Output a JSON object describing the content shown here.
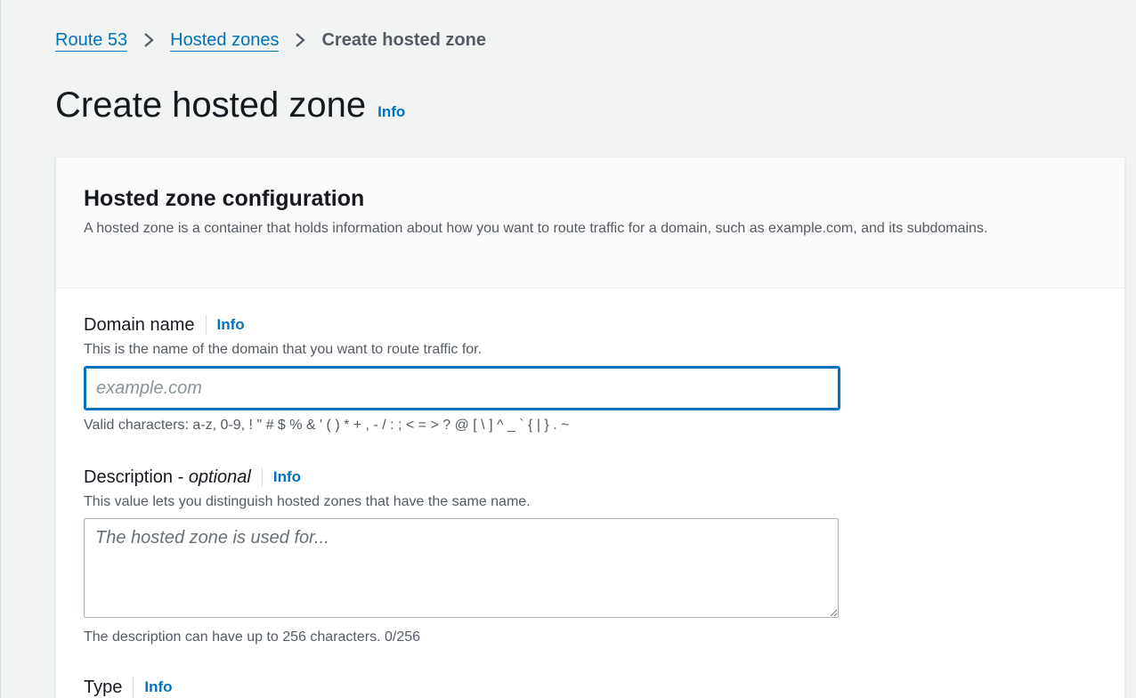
{
  "breadcrumb": {
    "items": [
      "Route 53",
      "Hosted zones"
    ],
    "current": "Create hosted zone"
  },
  "header": {
    "title": "Create hosted zone",
    "info": "Info"
  },
  "panel": {
    "title": "Hosted zone configuration",
    "description": "A hosted zone is a container that holds information about how you want to route traffic for a domain, such as example.com, and its subdomains."
  },
  "domain_name": {
    "label": "Domain name",
    "info": "Info",
    "description": "This is the name of the domain that you want to route traffic for.",
    "placeholder": "example.com",
    "value": "",
    "hint": "Valid characters: a-z, 0-9, ! \" # $ % & ' ( ) * + , - / : ; < = > ? @ [ \\ ] ^ _ ` { | } . ~"
  },
  "description_field": {
    "label": "Description - ",
    "label_optional": "optional",
    "info": "Info",
    "description": "This value lets you distinguish hosted zones that have the same name.",
    "placeholder": "The hosted zone is used for...",
    "value": "",
    "hint": "The description can have up to 256 characters. 0/256"
  },
  "type_field": {
    "label": "Type",
    "info": "Info"
  },
  "colors": {
    "link": "#0073bb",
    "text": "#16191f",
    "secondary_text": "#545b64",
    "background": "#f2f3f3"
  }
}
